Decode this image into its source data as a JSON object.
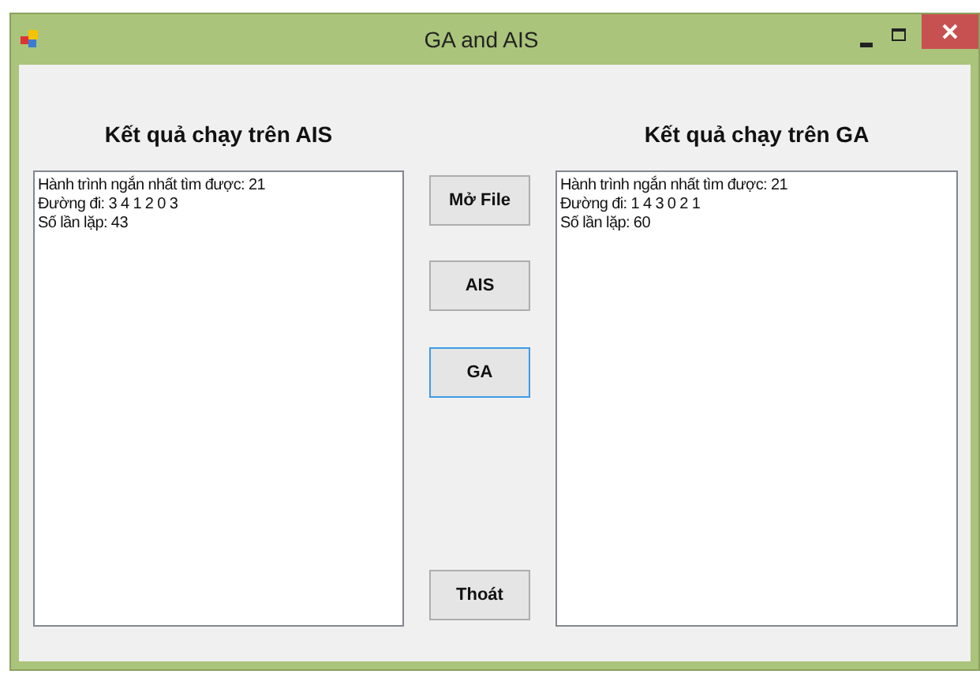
{
  "window": {
    "title": "GA and AIS"
  },
  "left_panel": {
    "heading": "Kết quả chạy trên AIS",
    "lines": [
      "Hành trình ngắn nhất tìm được: 21",
      "Đường đi: 3 4 1 2 0 3",
      "Số lần lặp: 43"
    ]
  },
  "buttons": [
    {
      "label": "Mở File",
      "focused": false
    },
    {
      "label": "AIS",
      "focused": false
    },
    {
      "label": "GA",
      "focused": true
    },
    {
      "label": "Thoát",
      "focused": false
    }
  ],
  "right_panel": {
    "heading": "Kết quả chạy trên GA",
    "lines": [
      "Hành trình ngắn nhất tìm được: 21",
      "Đường đi: 1 4 3 0 2 1",
      "Số lần lặp: 60"
    ]
  }
}
